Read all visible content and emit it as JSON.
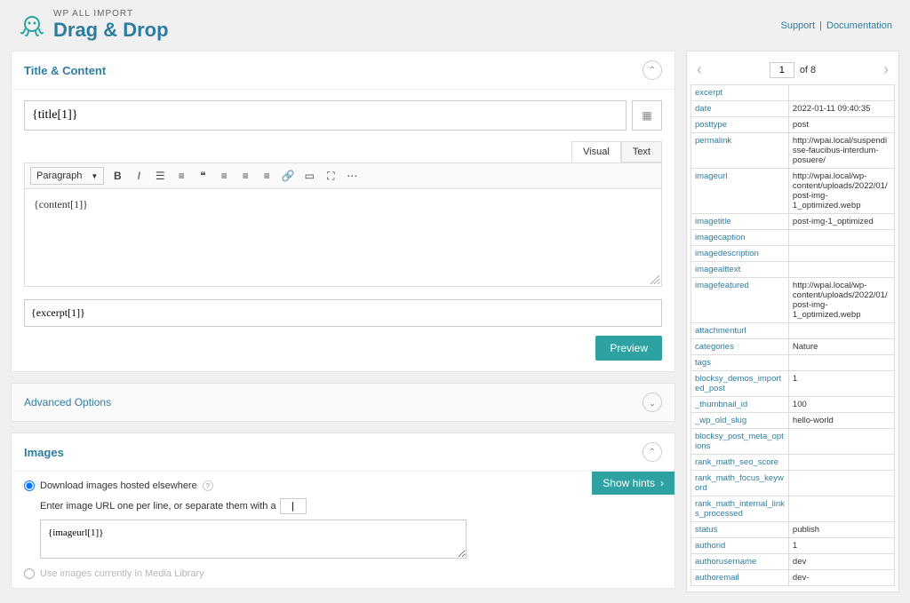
{
  "header": {
    "brand_small": "WP ALL IMPORT",
    "brand_large": "Drag & Drop",
    "links": [
      "Support",
      "Documentation"
    ]
  },
  "title_content": {
    "panel_title": "Title & Content",
    "title_value": "{title[1]}",
    "tabs": {
      "visual": "Visual",
      "text": "Text"
    },
    "format_label": "Paragraph",
    "content_value": "{content[1]}",
    "excerpt_value": "{excerpt[1]}",
    "preview_label": "Preview"
  },
  "advanced": {
    "title": "Advanced Options"
  },
  "images": {
    "panel_title": "Images",
    "radio1": "Download images hosted elsewhere",
    "url_desc_prefix": "Enter image URL one per line, or separate them with a",
    "separator": "|",
    "imageurl_value": "{imageurl[1]}",
    "show_hints": "Show hints",
    "radio2": "Use images currently in Media Library"
  },
  "pager": {
    "current": "1",
    "of_text": "of 8"
  },
  "data_rows": [
    {
      "k": "excerpt",
      "v": ""
    },
    {
      "k": "date",
      "v": "2022-01-11 09:40:35"
    },
    {
      "k": "posttype",
      "v": "post"
    },
    {
      "k": "permalink",
      "v": "http://wpai.local/suspendisse-faucibus-interdum-posuere/"
    },
    {
      "k": "imageurl",
      "v": "http://wpai.local/wp-content/uploads/2022/01/post-img-1_optimized.webp"
    },
    {
      "k": "imagetitle",
      "v": "post-img-1_optimized"
    },
    {
      "k": "imagecaption",
      "v": ""
    },
    {
      "k": "imagedescription",
      "v": ""
    },
    {
      "k": "imagealttext",
      "v": ""
    },
    {
      "k": "imagefeatured",
      "v": "http://wpai.local/wp-content/uploads/2022/01/post-img-1_optimized.webp"
    },
    {
      "k": "attachmenturl",
      "v": ""
    },
    {
      "k": "categories",
      "v": "Nature"
    },
    {
      "k": "tags",
      "v": ""
    },
    {
      "k": "blocksy_demos_imported_post",
      "v": "1"
    },
    {
      "k": "_thumbnail_id",
      "v": "100"
    },
    {
      "k": "_wp_old_slug",
      "v": "hello-world"
    },
    {
      "k": "blocksy_post_meta_options",
      "v": ""
    },
    {
      "k": "rank_math_seo_score",
      "v": ""
    },
    {
      "k": "rank_math_focus_keyword",
      "v": ""
    },
    {
      "k": "rank_math_internal_links_processed",
      "v": ""
    },
    {
      "k": "status",
      "v": "publish"
    },
    {
      "k": "authorid",
      "v": "1"
    },
    {
      "k": "authorusername",
      "v": "dev"
    },
    {
      "k": "authoremail",
      "v": "dev-"
    }
  ]
}
